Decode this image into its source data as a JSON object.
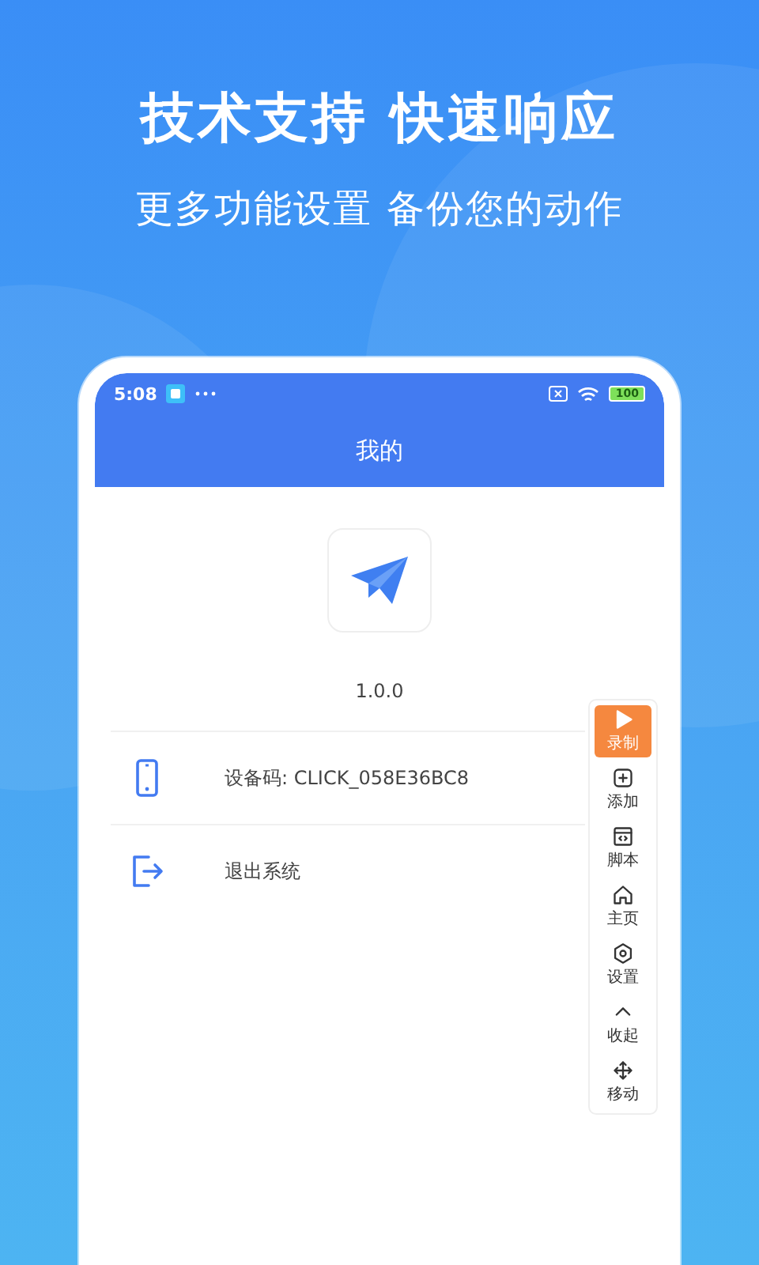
{
  "headline": "技术支持 快速响应",
  "subheadline": "更多功能设置 备份您的动作",
  "status_bar": {
    "time": "5:08",
    "battery": "100"
  },
  "app_bar": {
    "title": "我的"
  },
  "version": "1.0.0",
  "rows": [
    {
      "kind": "device",
      "label": "设备码: CLICK_058E36BC8"
    },
    {
      "kind": "logout",
      "label": "退出系统"
    }
  ],
  "toolbar": [
    {
      "kind": "play",
      "label": "录制",
      "selected": true
    },
    {
      "kind": "add",
      "label": "添加",
      "selected": false
    },
    {
      "kind": "script",
      "label": "脚本",
      "selected": false
    },
    {
      "kind": "home",
      "label": "主页",
      "selected": false
    },
    {
      "kind": "settings",
      "label": "设置",
      "selected": false
    },
    {
      "kind": "collapse",
      "label": "收起",
      "selected": false
    },
    {
      "kind": "move",
      "label": "移动",
      "selected": false
    }
  ]
}
